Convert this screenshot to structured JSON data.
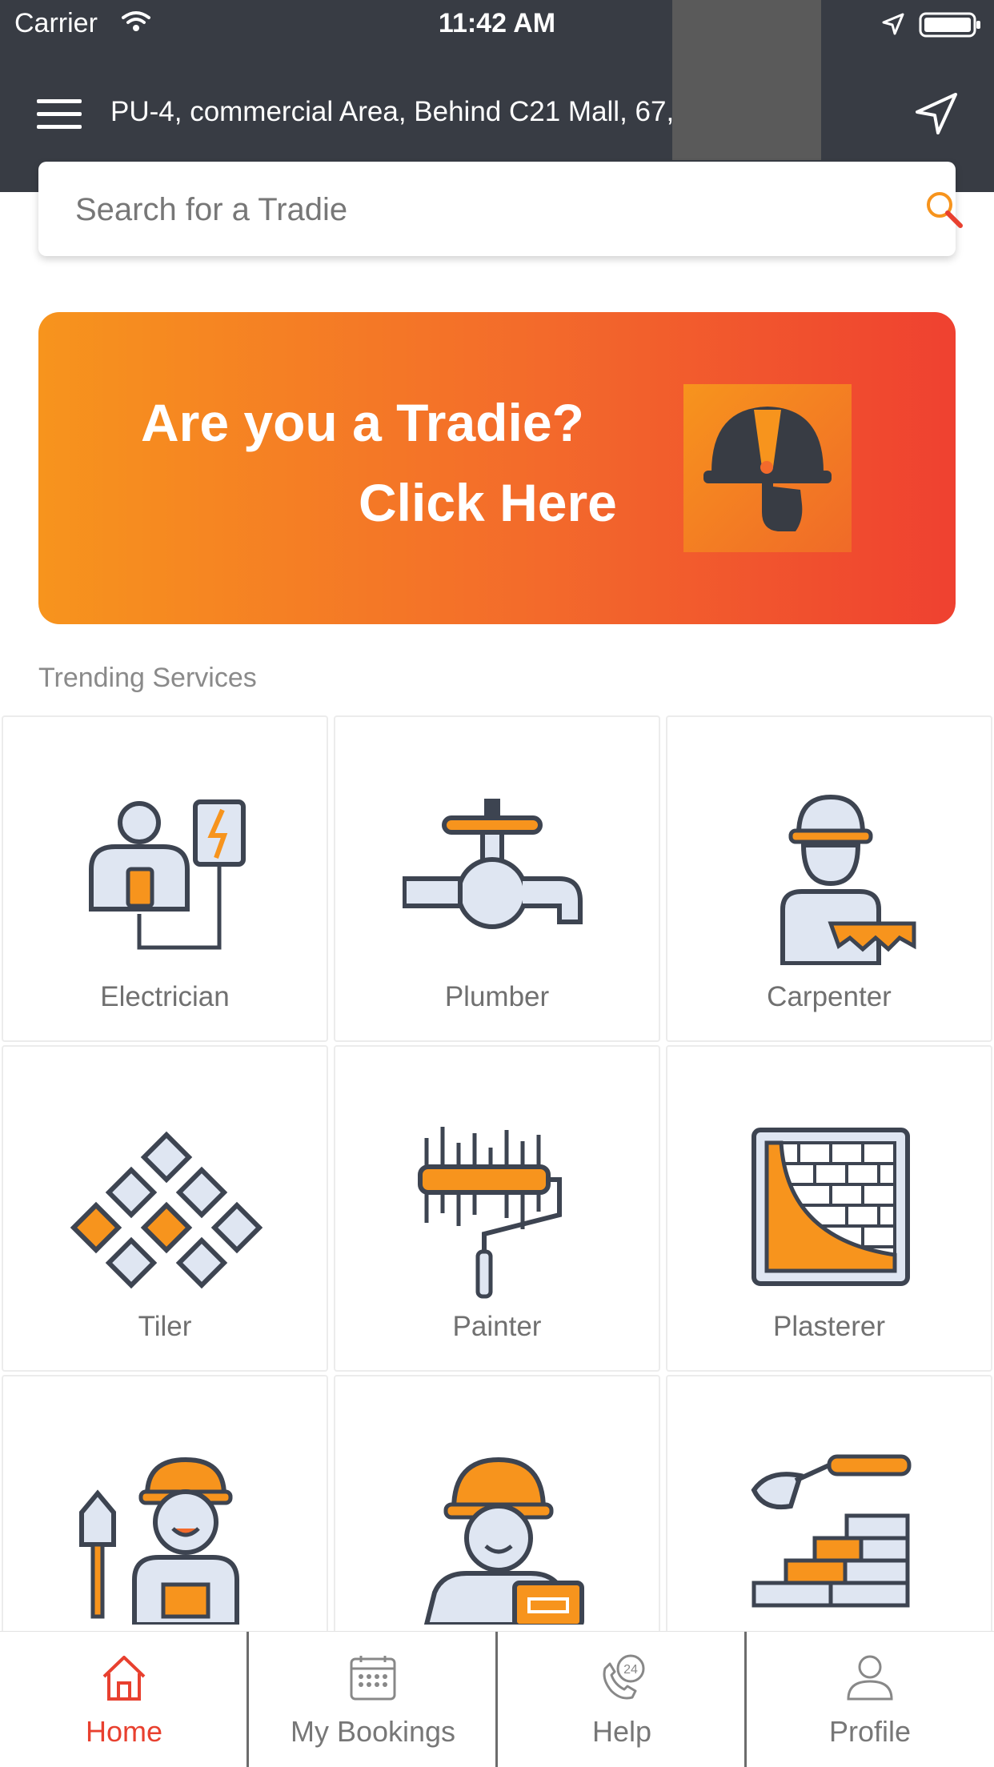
{
  "status_bar": {
    "carrier": "Carrier",
    "time": "11:42 AM"
  },
  "header": {
    "address": "PU-4, commercial Area, Behind C21 Mall, 67, viy…"
  },
  "search": {
    "placeholder": "Search for a Tradie"
  },
  "banner": {
    "line1": "Are you a Tradie?",
    "line2": "Click Here"
  },
  "section_title": "Trending Services",
  "services": [
    {
      "label": "Electrician",
      "icon": "electrician-icon"
    },
    {
      "label": "Plumber",
      "icon": "plumber-icon"
    },
    {
      "label": "Carpenter",
      "icon": "carpenter-icon"
    },
    {
      "label": "Tiler",
      "icon": "tiler-icon"
    },
    {
      "label": "Painter",
      "icon": "painter-icon"
    },
    {
      "label": "Plasterer",
      "icon": "plasterer-icon"
    },
    {
      "label": "",
      "icon": "gardener-worker-icon"
    },
    {
      "label": "",
      "icon": "battery-technician-icon"
    },
    {
      "label": "",
      "icon": "bricklayer-icon"
    }
  ],
  "bottom_nav": [
    {
      "label": "Home",
      "icon": "home-icon",
      "active": true
    },
    {
      "label": "My Bookings",
      "icon": "calendar-icon",
      "active": false
    },
    {
      "label": "Help",
      "icon": "support-24-icon",
      "active": false
    },
    {
      "label": "Profile",
      "icon": "user-icon",
      "active": false
    }
  ],
  "colors": {
    "header": "#383c44",
    "accent": "#f7941d",
    "active": "#e8402f",
    "icon_stroke": "#3d4451"
  }
}
